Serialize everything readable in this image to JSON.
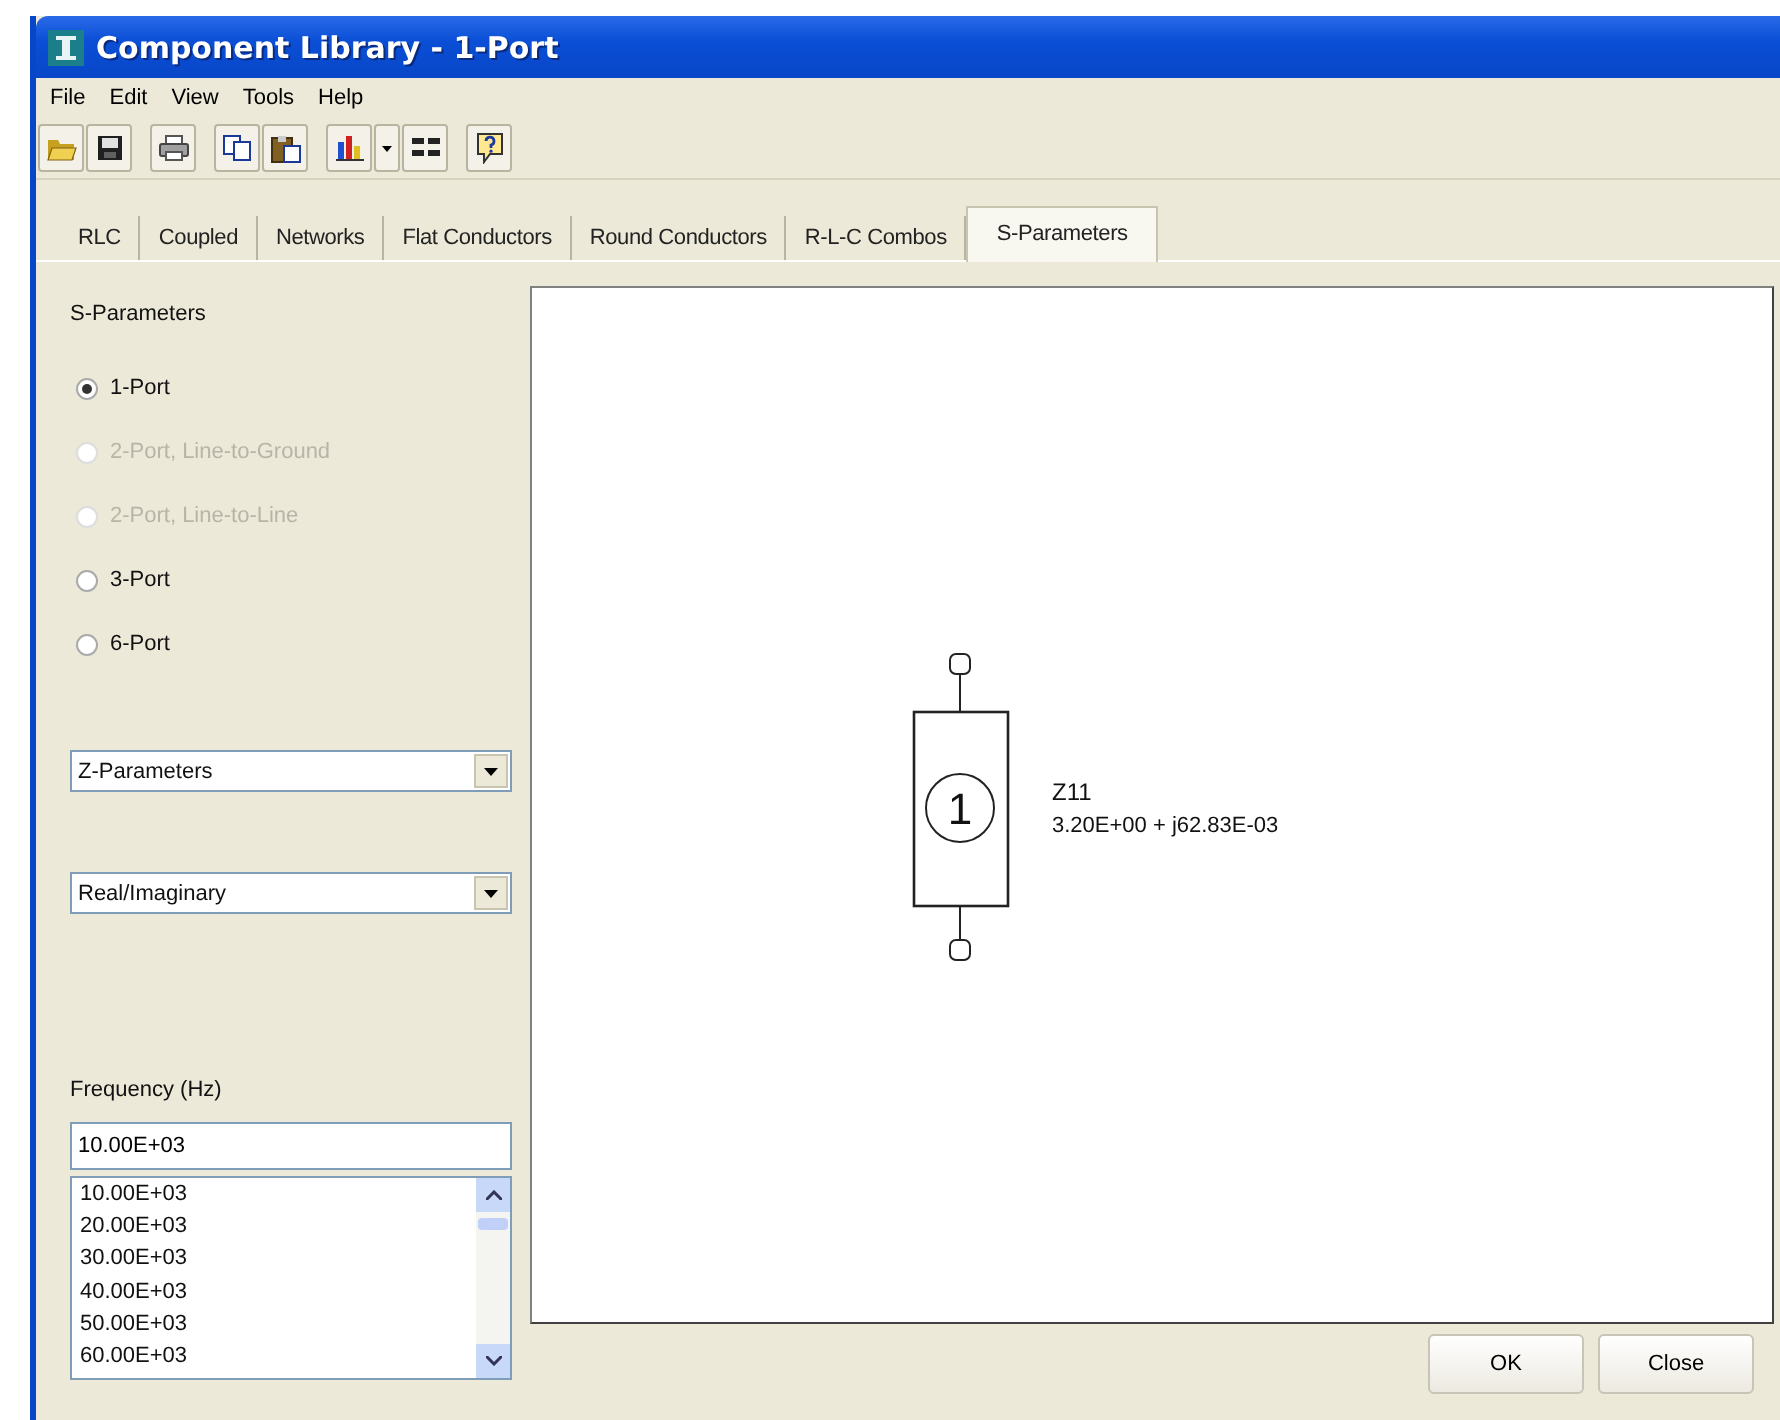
{
  "window": {
    "title": "Component Library - 1-Port"
  },
  "menu": [
    "File",
    "Edit",
    "View",
    "Tools",
    "Help"
  ],
  "tabs": [
    {
      "label": "RLC",
      "selected": false
    },
    {
      "label": "Coupled",
      "selected": false
    },
    {
      "label": "Networks",
      "selected": false
    },
    {
      "label": "Flat Conductors",
      "selected": false
    },
    {
      "label": "Round Conductors",
      "selected": false
    },
    {
      "label": "R-L-C Combos",
      "selected": false
    },
    {
      "label": "S-Parameters",
      "selected": true
    }
  ],
  "group": {
    "title": "S-Parameters",
    "options": [
      {
        "label": "1-Port",
        "selected": true,
        "disabled": false
      },
      {
        "label": "2-Port, Line-to-Ground",
        "selected": false,
        "disabled": true
      },
      {
        "label": "2-Port, Line-to-Line",
        "selected": false,
        "disabled": true
      },
      {
        "label": "3-Port",
        "selected": false,
        "disabled": false
      },
      {
        "label": "6-Port",
        "selected": false,
        "disabled": false
      }
    ]
  },
  "parameter_select": {
    "value": "Z-Parameters"
  },
  "format_select": {
    "value": "Real/Imaginary"
  },
  "frequency": {
    "label": "Frequency (Hz)",
    "value": "10.00E+03",
    "list": [
      "10.00E+03",
      "20.00E+03",
      "30.00E+03",
      "40.00E+03",
      "50.00E+03",
      "60.00E+03"
    ]
  },
  "schematic": {
    "port_label": "1",
    "parameter": "Z11",
    "reading": "3.20E+00 + j62.83E-03"
  },
  "buttons": [
    "OK",
    "Close"
  ]
}
